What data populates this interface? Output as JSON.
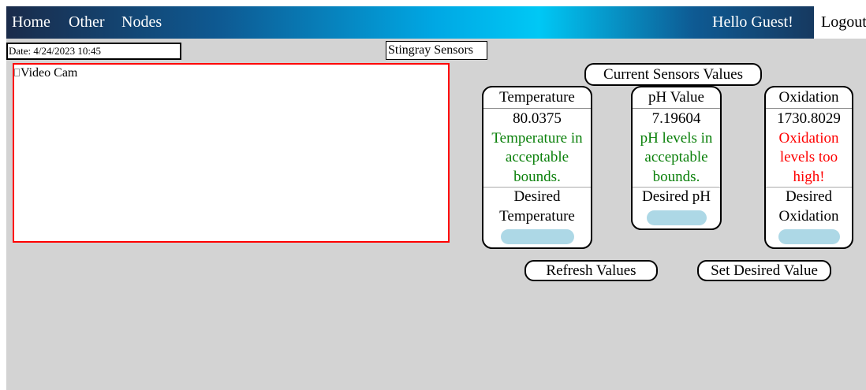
{
  "nav": {
    "home": "Home",
    "other": "Other",
    "nodes": "Nodes",
    "greeting": "Hello Guest!",
    "logout": "Logout"
  },
  "header": {
    "date": "Date: 4/24/2023 10:45",
    "title": "Stingray Sensors"
  },
  "video": {
    "alt": "Video Cam"
  },
  "sensors": {
    "section_title": "Current Sensors Values",
    "temperature": {
      "title": "Temperature",
      "value": "80.0375",
      "status": "Temperature in acceptable bounds.",
      "status_color": "#0a800a",
      "desired_label": "Desired Temperature"
    },
    "ph": {
      "title": "pH Value",
      "value": "7.19604",
      "status": "pH levels in acceptable bounds.",
      "status_color": "#0a800a",
      "desired_label": "Desired pH"
    },
    "oxidation": {
      "title": "Oxidation",
      "value": "1730.8029",
      "status": "Oxidation levels too high!",
      "status_color": "#ff0000",
      "desired_label": "Desired Oxidation"
    }
  },
  "buttons": {
    "refresh": "Refresh Values",
    "set_desired": "Set Desired Value"
  },
  "colors": {
    "input_fill": "#add8e6",
    "video_border": "#ff0000",
    "page_background": "#d3d3d3"
  }
}
